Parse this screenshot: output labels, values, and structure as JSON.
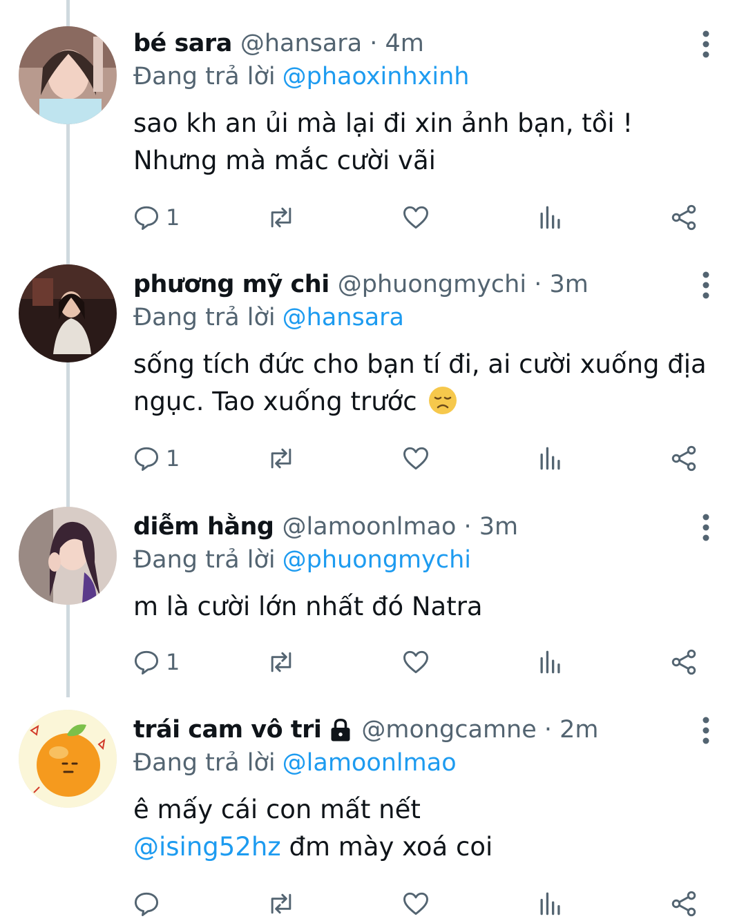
{
  "tweets": [
    {
      "name": "bé sara",
      "handle_time": "@hansara · 4m",
      "reply_prefix": "Đang trả lời",
      "reply_to": "@phaoxinhxinh",
      "text": "sao kh an ủi mà lại đi xin ảnh bạn, tồi ! Nhưng mà mắc cười vãi",
      "reply_count": "1"
    },
    {
      "name": "phương mỹ chi",
      "handle_time": "@phuongmychi · 3m",
      "reply_prefix": "Đang trả lời",
      "reply_to": "@hansara",
      "text": "sống tích đức cho bạn tí đi, ai cười xuống địa ngục. Tao xuống trước",
      "emoji": "disappointed-face",
      "reply_count": "1"
    },
    {
      "name": "diễm hằng",
      "handle_time": "@lamoonlmao · 3m",
      "reply_prefix": "Đang trả lời",
      "reply_to": "@phuongmychi",
      "text": "m là cười lớn nhất đó Natra",
      "reply_count": "1"
    },
    {
      "name": "trái cam vô tri",
      "handle_time": "@mongcamne · 2m",
      "reply_prefix": "Đang trả lời",
      "reply_to": "@lamoonlmao",
      "text_line1": "ê mấy cái con mất nết",
      "text_mention": "@ising52hz",
      "text_line2_rest": " đm mày xoá coi",
      "locked": true,
      "reply_count": ""
    }
  ],
  "colors": {
    "text": "#0f1419",
    "secondary": "#536471",
    "link": "#1d9bf0",
    "thread_line": "#cfd9de"
  },
  "icons": [
    "reply-icon",
    "retweet-icon",
    "like-icon",
    "views-icon",
    "share-icon",
    "more-icon",
    "lock-icon"
  ]
}
